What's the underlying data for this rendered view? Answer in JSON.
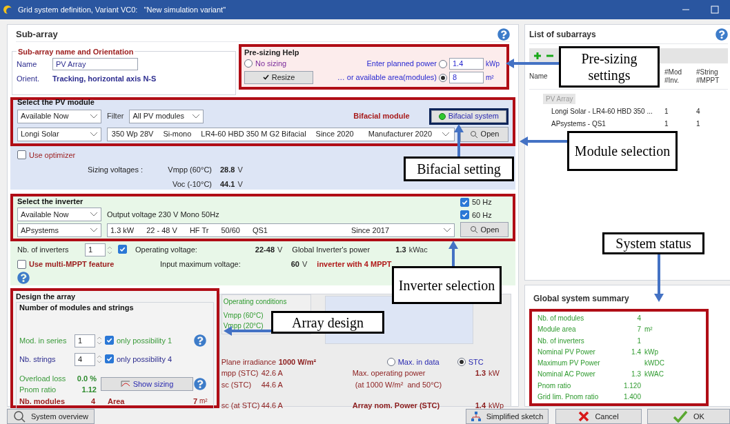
{
  "window": {
    "title": "Grid system definition, Variant VC0:   \"New simulation variant\""
  },
  "sub_array": {
    "heading": "Sub-array",
    "name_orientation": {
      "legend": "Sub-array name and Orientation",
      "name_label": "Name",
      "name_value": "PV Array",
      "orient_label": "Orient.",
      "orient_value": "Tracking, horizontal axis N-S"
    },
    "presizing": {
      "title": "Pre-sizing Help",
      "resize_button": "Resize",
      "options": [
        {
          "label": "No sizing",
          "selected": false
        },
        {
          "label": "Enter planned power",
          "selected": false,
          "value": "1.4",
          "unit": "kWp"
        },
        {
          "label": "… or available area(modules)",
          "selected": true,
          "value": "8",
          "unit": "m²"
        }
      ]
    },
    "pv_module": {
      "legend": "Select the PV module",
      "availability": "Available Now",
      "filter_label": "Filter",
      "filter": "All PV modules",
      "bifacial_label": "Bifacial module",
      "bifacial_button": {
        "label": "Bifacial system",
        "on": true
      },
      "manufacturer": "Longi Solar",
      "model_fields": [
        "350 Wp 28V",
        "Si-mono",
        "LR4-60 HBD 350 M G2 Bifacial",
        "Since 2020"
      ],
      "model_source": "Manufacturer 2020",
      "open_button": "Open",
      "optimizer": {
        "label": "Use optimizer",
        "checked": false
      },
      "sizing_label": "Sizing voltages :",
      "voltages": [
        {
          "label": "Vmpp (60°C)",
          "value": "28.8",
          "unit": "V"
        },
        {
          "label": "Voc (-10°C)",
          "value": "44.1",
          "unit": "V"
        }
      ]
    },
    "inverter": {
      "legend": "Select the inverter",
      "availability": "Available Now",
      "output_voltage": "Output voltage 230 V Mono 50Hz",
      "frequencies": [
        {
          "label": "50 Hz",
          "checked": true
        },
        {
          "label": "60 Hz",
          "checked": true
        }
      ],
      "manufacturer": "APsystems",
      "model_fields": [
        "1.3 kW",
        "22 - 48 V",
        "HF Tr",
        "50/60",
        "QS1"
      ],
      "model_since": "Since 2017",
      "open_button": "Open",
      "nb_label": "Nb. of inverters",
      "nb_value": "1",
      "nb_checked": true,
      "multi_mppt": {
        "label": "Use multi-MPPT feature",
        "checked": false
      },
      "specs": [
        {
          "label": "Operating voltage:",
          "value": "22-48",
          "unit": "V"
        },
        {
          "label": "Input maximum voltage:",
          "value": "60",
          "unit": "V"
        }
      ],
      "global_label": "Global Inverter's power",
      "global_value": "1.3",
      "global_unit": "kWac",
      "mppt_note": "inverter with 4 MPPT"
    },
    "design": {
      "legend": "Design the array",
      "sub_legend": "Number of modules and strings",
      "rows": [
        {
          "label": "Mod. in series",
          "value": "1",
          "check_label": "only possibility 1",
          "checked": true
        },
        {
          "label": "Nb. strings",
          "value": "4",
          "check_label": "only possibility 4",
          "checked": true
        }
      ],
      "overload_label": "Overload loss",
      "overload": "0.0 %",
      "pnom_label": "Pnom ratio",
      "pnom": "1.12",
      "show_sizing": "Show sizing",
      "nb_modules_label": "Nb. modules",
      "nb_modules": "4",
      "area_label": "Area",
      "area": "7",
      "area_unit": "m²"
    },
    "operating_conditions": {
      "title": "Operating conditions",
      "items": [
        "Vmpp (60°C)",
        "Vmpp (20°C)"
      ]
    },
    "stc": {
      "irradiance_label": "Plane irradiance",
      "irradiance": "1000 W/m²",
      "rows": [
        {
          "label": "mpp (STC)",
          "value": "42.6 A"
        },
        {
          "label": "sc (STC)",
          "value": "44.6 A"
        },
        {
          "label": "sc (at STC)",
          "value": "44.6 A"
        }
      ],
      "radios": [
        {
          "label": "Max. in data",
          "selected": false
        },
        {
          "label": "STC",
          "selected": true
        }
      ],
      "max_power_label": "Max. operating power",
      "max_power_note": "(at 1000 W/m²  and 50°C)",
      "max_power": "1.3",
      "max_power_unit": "kW",
      "nom_power_label": "Array nom. Power (STC)",
      "nom_power": "1.4",
      "nom_power_unit": "kWp"
    }
  },
  "subarrays": {
    "title": "List of subarrays",
    "columns": [
      [
        "Name"
      ],
      [
        "#Mod",
        "#Inv."
      ],
      [
        "#String",
        "#MPPT"
      ]
    ],
    "tree": {
      "name": "PV Array",
      "children": [
        {
          "name": "Longi Solar - LR4-60 HBD 350 ...",
          "mod": "1",
          "string": "4"
        },
        {
          "name": "APsystems - QS1",
          "mod": "1",
          "string": "1"
        }
      ]
    }
  },
  "summary": {
    "title": "Global system summary",
    "rows": [
      {
        "label": "Nb. of modules",
        "value": "4"
      },
      {
        "label": "Module area",
        "value": "7",
        "unit": "m²"
      },
      {
        "label": "Nb. of inverters",
        "value": "1"
      },
      {
        "label": "Nominal PV Power",
        "value": "1.4",
        "unit": "kWp"
      },
      {
        "label": "Maximum PV Power",
        "unit": "kWDC"
      },
      {
        "label": "Nominal AC Power",
        "value": "1.3",
        "unit": "kWAC"
      },
      {
        "label": "Pnom ratio",
        "value": "1.120"
      },
      {
        "label": "Grid lim. Pnom ratio",
        "value": "1.400"
      }
    ]
  },
  "buttons": [
    {
      "label": "System overview",
      "kind": "overview"
    },
    {
      "label": "Simplified sketch",
      "kind": "sketch"
    },
    {
      "label": "Cancel",
      "kind": "cancel"
    },
    {
      "label": "OK",
      "kind": "ok"
    }
  ],
  "annotations": [
    {
      "text": "Pre-sizing settings"
    },
    {
      "text": "Module selection"
    },
    {
      "text": "Bifacial setting"
    },
    {
      "text": "System status"
    },
    {
      "text": "Inverter selection"
    },
    {
      "text": "Array design"
    }
  ]
}
